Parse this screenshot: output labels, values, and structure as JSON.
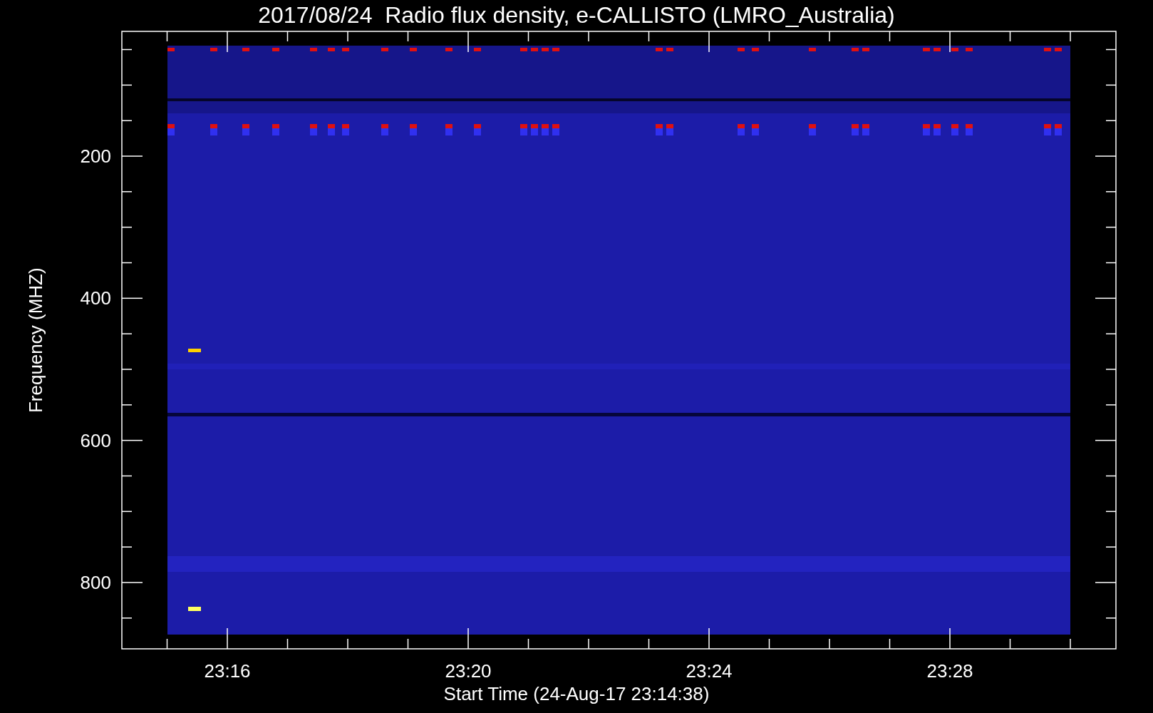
{
  "title": "2017/08/24  Radio flux density, e-CALLISTO (LMRO_Australia)",
  "y_axis": {
    "label": "Frequency (MHZ)",
    "ticks": [
      "200",
      "400",
      "600",
      "800"
    ]
  },
  "x_axis": {
    "label": "Start Time (24-Aug-17 23:14:38)",
    "ticks": [
      "23:16",
      "23:20",
      "23:24",
      "23:28"
    ]
  }
}
